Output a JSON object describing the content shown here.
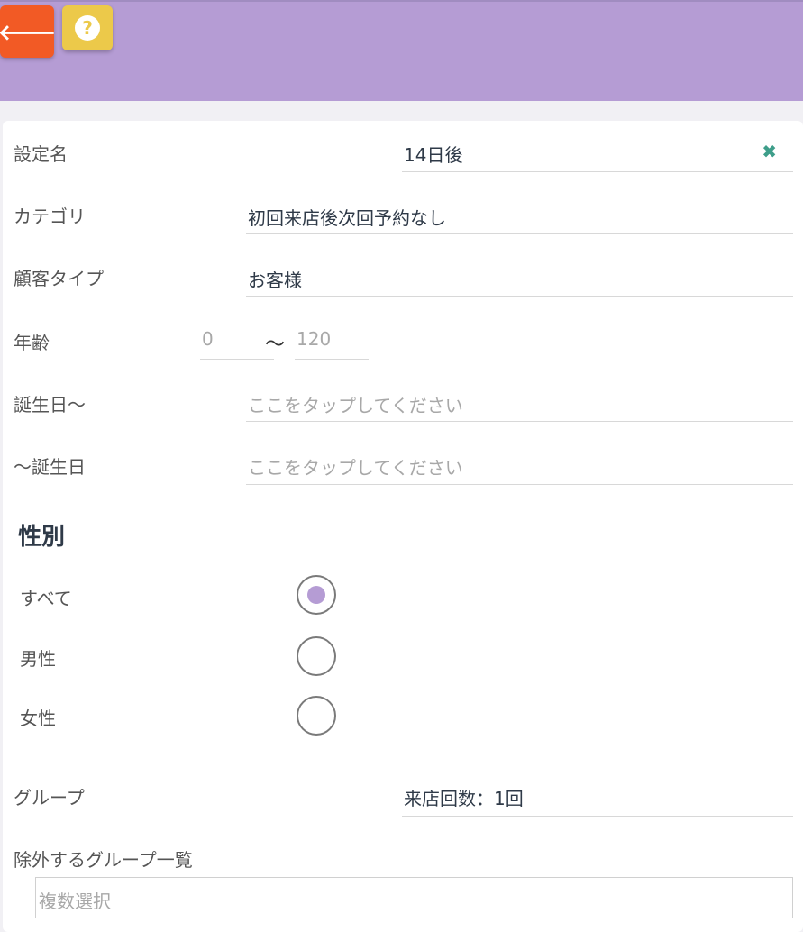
{
  "header": {
    "back_icon": "arrow-left-icon",
    "help_icon": "question-icon",
    "help_glyph": "?",
    "back_glyph": "🡐"
  },
  "form": {
    "setting_name": {
      "label": "設定名",
      "value": "14日後",
      "clear_glyph": "✖"
    },
    "category": {
      "label": "カテゴリ",
      "value": "初回来店後次回予約なし"
    },
    "customer_type": {
      "label": "顧客タイプ",
      "value": "お客様"
    },
    "age": {
      "label": "年齢",
      "min": "0",
      "separator": "〜",
      "max": "120"
    },
    "birthday_from": {
      "label": "誕生日〜",
      "placeholder": "ここをタップしてください"
    },
    "birthday_to": {
      "label": "〜誕生日",
      "placeholder": "ここをタップしてください"
    }
  },
  "gender": {
    "title": "性別",
    "options": [
      {
        "label": "すべて",
        "selected": true
      },
      {
        "label": "男性",
        "selected": false
      },
      {
        "label": "女性",
        "selected": false
      }
    ]
  },
  "group": {
    "label": "グループ",
    "value": "来店回数：1回"
  },
  "exclude_groups": {
    "label": "除外するグループ一覧",
    "placeholder": "複数選択"
  },
  "colors": {
    "header": "#b59cd4",
    "back_button": "#f25a25",
    "help_button": "#ecc94a",
    "clear_icon": "#3e9e8a",
    "radio_selected": "#b59cd4"
  }
}
